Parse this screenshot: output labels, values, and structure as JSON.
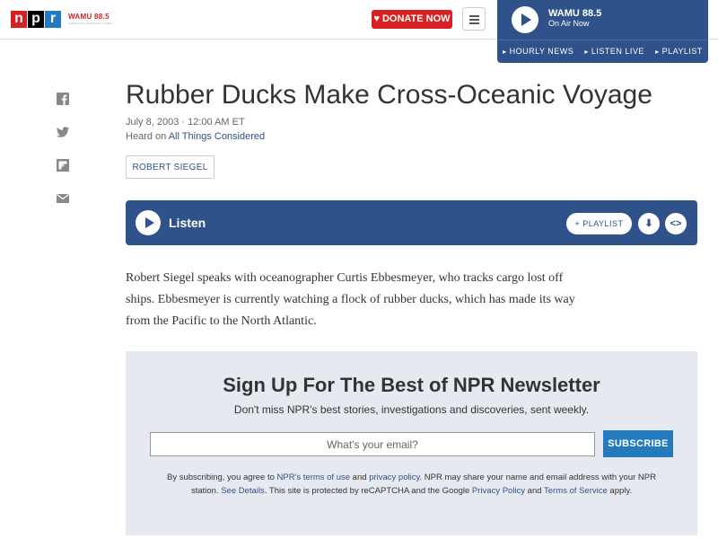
{
  "header": {
    "logo_letters": [
      "n",
      "p",
      "r"
    ],
    "station_logo": "WAMU 88.5",
    "station_tagline": "AMERICAN UNIVERSITY RADIO",
    "donate_label": "DONATE NOW",
    "menu_icon": "hamburger-menu-icon"
  },
  "player": {
    "station": "WAMU 88.5",
    "status": "On Air Now",
    "links": [
      "HOURLY NEWS",
      "LISTEN LIVE",
      "PLAYLIST"
    ]
  },
  "share": {
    "icons": [
      "facebook-icon",
      "twitter-icon",
      "flipboard-icon",
      "email-icon"
    ]
  },
  "article": {
    "title": "Rubber Ducks Make Cross-Oceanic Voyage",
    "date": "July 8, 2003 · 12:00 AM ET",
    "heard_on_prefix": "Heard on",
    "program": "All Things Considered",
    "byline": "ROBERT SIEGEL",
    "body": "Robert Siegel speaks with oceanographer Curtis Ebbesmeyer, who tracks cargo lost off ships. Ebbesmeyer is currently watching a flock of rubber ducks, which has made its way from the Pacific to the North Atlantic."
  },
  "listen": {
    "label": "Listen",
    "playlist_label": "+ PLAYLIST",
    "download_glyph": "⬇",
    "embed_glyph": "<>"
  },
  "newsletter": {
    "title": "Sign Up For The Best of NPR Newsletter",
    "subtitle": "Don't miss NPR's best stories, investigations and discoveries, sent weekly.",
    "email_placeholder": "What's your email?",
    "subscribe_label": "SUBSCRIBE",
    "legal": {
      "t1": "By subscribing, you agree to ",
      "l1": "NPR's terms of use",
      "t2": " and ",
      "l2": "privacy policy",
      "t3": ". NPR may share your name and email address with your NPR station. ",
      "l3": "See Details",
      "t4": ". This site is protected by reCAPTCHA and the Google ",
      "l4": "Privacy Policy",
      "t5": " and ",
      "l5": "Terms of Service",
      "t6": " apply."
    }
  },
  "colors": {
    "npr_red": "#d62021",
    "npr_blue": "#237bbd",
    "player_blue": "#2e5289",
    "newsletter_bg": "#e6e9ef"
  }
}
